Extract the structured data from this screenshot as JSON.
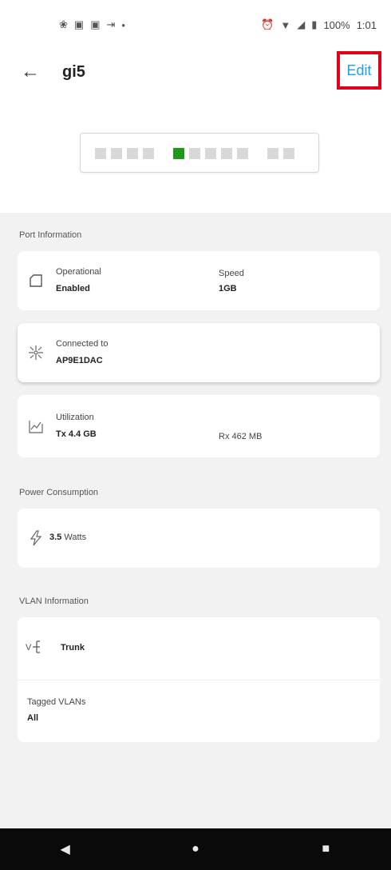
{
  "statusbar": {
    "left_icons": [
      "❀",
      "▣",
      "▣",
      "⇥",
      "•"
    ],
    "alarm": "⏰",
    "wifi": "▼",
    "signal": "◢",
    "battery": "▮",
    "battery_text": "100%",
    "time": "1:01"
  },
  "appbar": {
    "back_icon": "←",
    "title": "gi5",
    "edit_label": "Edit"
  },
  "portstrip": {
    "active_port_index": 4,
    "port_count": 11,
    "active_color": "#1c9a1c"
  },
  "sections": {
    "port_information": "Port Information",
    "power_consumption": "Power Consumption",
    "vlan_information": "VLAN Information"
  },
  "operational": {
    "label": "Operational",
    "value": "Enabled",
    "speed_label": "Speed",
    "speed_value": "1GB"
  },
  "connected": {
    "label": "Connected to",
    "value": "AP9E1DAC"
  },
  "utilization": {
    "label": "Utilization",
    "tx": "Tx 4.4 GB",
    "rx": "Rx  462 MB"
  },
  "power": {
    "value": "3.5",
    "unit": "Watts"
  },
  "vlan": {
    "mode": "Trunk",
    "tagged_label": "Tagged VLANs",
    "tagged_value": "All"
  },
  "navbar": {
    "back": "◀",
    "home": "●",
    "recents": "■"
  }
}
